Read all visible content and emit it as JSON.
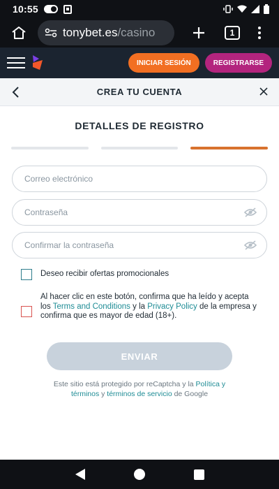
{
  "status_bar": {
    "time": "10:55"
  },
  "browser": {
    "url_host": "tonybet.es",
    "url_path": "/casino",
    "tab_count": "1"
  },
  "site_header": {
    "login_label": "INICIAR SESIÓN",
    "register_label": "REGISTRARSE",
    "colors": {
      "header_bg": "#1b2430",
      "login": "#f26f22",
      "register": "#b3247e"
    }
  },
  "modal": {
    "title": "CREA TU CUENTA",
    "section_title": "DETALLES DE REGISTRO",
    "progress": {
      "steps": 3,
      "current": 3
    }
  },
  "form": {
    "email_placeholder": "Correo electrónico",
    "password_placeholder": "Contraseña",
    "confirm_password_placeholder": "Confirmar la contraseña",
    "promo_label": "Deseo recibir ofertas promocionales",
    "terms": {
      "part1": "Al hacer clic en este botón, confirma que ha leído y acepta los ",
      "link1": "Terms and Conditions",
      "part2": " y la ",
      "link2": "Privacy Policy",
      "part3": " de la empresa y confirma que es mayor de edad (18+)."
    },
    "submit_label": "ENVIAR"
  },
  "recaptcha": {
    "part1": "Este sitio está protegido por reCaptcha y la ",
    "link1": "Política y términos",
    "part2": " y ",
    "link2": "términos de servicio",
    "part3": " de Google"
  },
  "colors": {
    "accent_orange": "#d8722e",
    "link_teal": "#1e8c95",
    "promo_checkbox": "#2e7d8c",
    "terms_checkbox_error": "#d9534f",
    "submit_disabled": "#c8d2dc"
  }
}
